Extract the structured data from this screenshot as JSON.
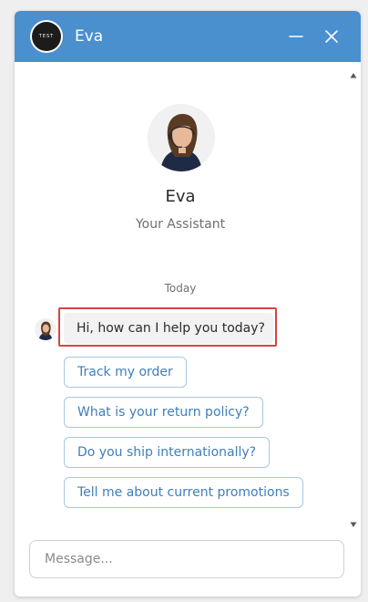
{
  "header": {
    "logo_text": "TEST",
    "title": "Eva",
    "minimize_icon": "minimize-icon",
    "close_icon": "close-icon",
    "background_color": "#4a8fce"
  },
  "profile": {
    "avatar_icon": "agent-avatar",
    "name": "Eva",
    "role": "Your Assistant"
  },
  "conversation": {
    "date_label": "Today",
    "messages": [
      {
        "sender": "Eva",
        "text": "Hi, how can I help you today?"
      }
    ],
    "quick_replies": [
      "Track my order",
      "What is your return policy?",
      "Do you ship internationally?",
      "Tell me about current promotions"
    ]
  },
  "composer": {
    "placeholder": "Message...",
    "value": ""
  },
  "colors": {
    "accent": "#4a8fce",
    "quick_reply_text": "#3f7fb8",
    "highlight_border": "#d64541"
  }
}
